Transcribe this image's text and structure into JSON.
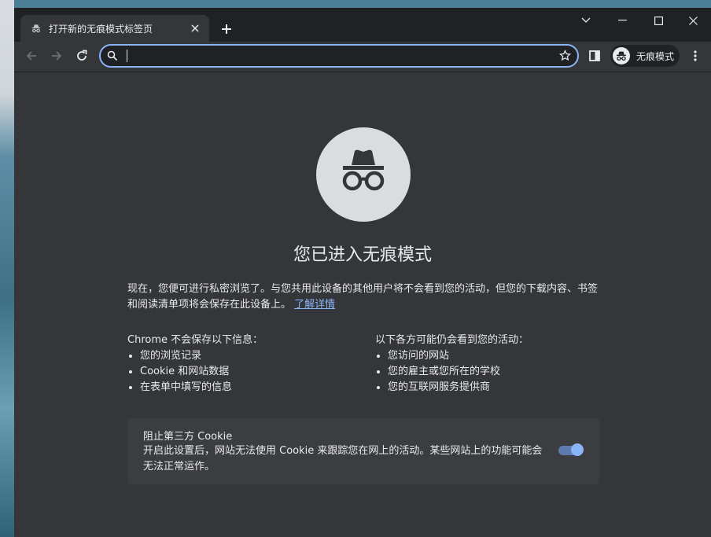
{
  "tab": {
    "title": "打开新的无痕模式标签页"
  },
  "toolbar": {
    "omnibox_value": "",
    "profile_label": "无痕模式"
  },
  "page": {
    "heading": "您已进入无痕模式",
    "intro_text": "现在，您便可进行私密浏览了。与您共用此设备的其他用户将不会看到您的活动，但您的下载内容、书签和阅读清单项将会保存在此设备上。",
    "learn_more": "了解详情",
    "left_column": {
      "title": "Chrome 不会保存以下信息：",
      "items": [
        "您的浏览记录",
        "Cookie 和网站数据",
        "在表单中填写的信息"
      ]
    },
    "right_column": {
      "title": "以下各方可能仍会看到您的活动：",
      "items": [
        "您访问的网站",
        "您的雇主或您所在的学校",
        "您的互联网服务提供商"
      ]
    },
    "cookie_card": {
      "title": "阻止第三方 Cookie",
      "description": "开启此设置后，网站无法使用 Cookie 来跟踪您在网上的活动。某些网站上的功能可能会无法正常运作。",
      "toggle_on": true
    }
  },
  "colors": {
    "background": "#35363a",
    "tabstrip": "#202124",
    "accent": "#8ab4f8",
    "text": "#e8eaed"
  },
  "icons": [
    "incognito-icon",
    "close-icon",
    "plus-icon",
    "chevron-down-icon",
    "minimize-icon",
    "maximize-icon",
    "back-icon",
    "forward-icon",
    "reload-icon",
    "search-icon",
    "star-icon",
    "side-panel-icon",
    "more-icon"
  ]
}
